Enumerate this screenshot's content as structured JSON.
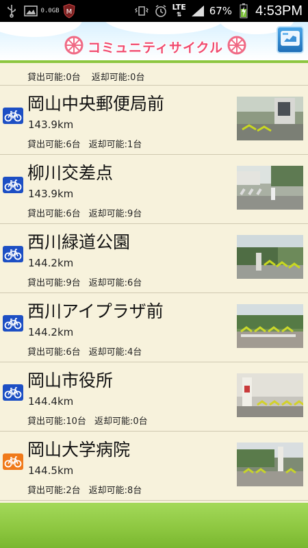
{
  "status_bar": {
    "net_speed_top": "0.0",
    "net_speed_bottom": "GB",
    "network": "LTE",
    "battery": "67%",
    "time": "4:53PM"
  },
  "header": {
    "title": "コミュニティサイクル"
  },
  "partial_row": {
    "rent": "貸出可能:0台",
    "ret": "返却可能:0台"
  },
  "stations": [
    {
      "name": "岡山中央郵便局前",
      "distance": "143.9km",
      "rent": "貸出可能:6台",
      "ret": "返却可能:1台",
      "badge_color": "#1d4fc4"
    },
    {
      "name": "柳川交差点",
      "distance": "143.9km",
      "rent": "貸出可能:6台",
      "ret": "返却可能:9台",
      "badge_color": "#1d4fc4"
    },
    {
      "name": "西川緑道公園",
      "distance": "144.2km",
      "rent": "貸出可能:9台",
      "ret": "返却可能:6台",
      "badge_color": "#1d4fc4"
    },
    {
      "name": "西川アイプラザ前",
      "distance": "144.2km",
      "rent": "貸出可能:6台",
      "ret": "返却可能:4台",
      "badge_color": "#1d4fc4"
    },
    {
      "name": "岡山市役所",
      "distance": "144.4km",
      "rent": "貸出可能:10台",
      "ret": "返却可能:0台",
      "badge_color": "#1d4fc4"
    },
    {
      "name": "岡山大学病院",
      "distance": "144.5km",
      "rent": "貸出可能:2台",
      "ret": "返却可能:8台",
      "badge_color": "#f07a1a"
    }
  ],
  "colors": {
    "accent_green": "#8cc63f",
    "title_pink": "#f04a6e",
    "background": "#f7f2dc"
  }
}
